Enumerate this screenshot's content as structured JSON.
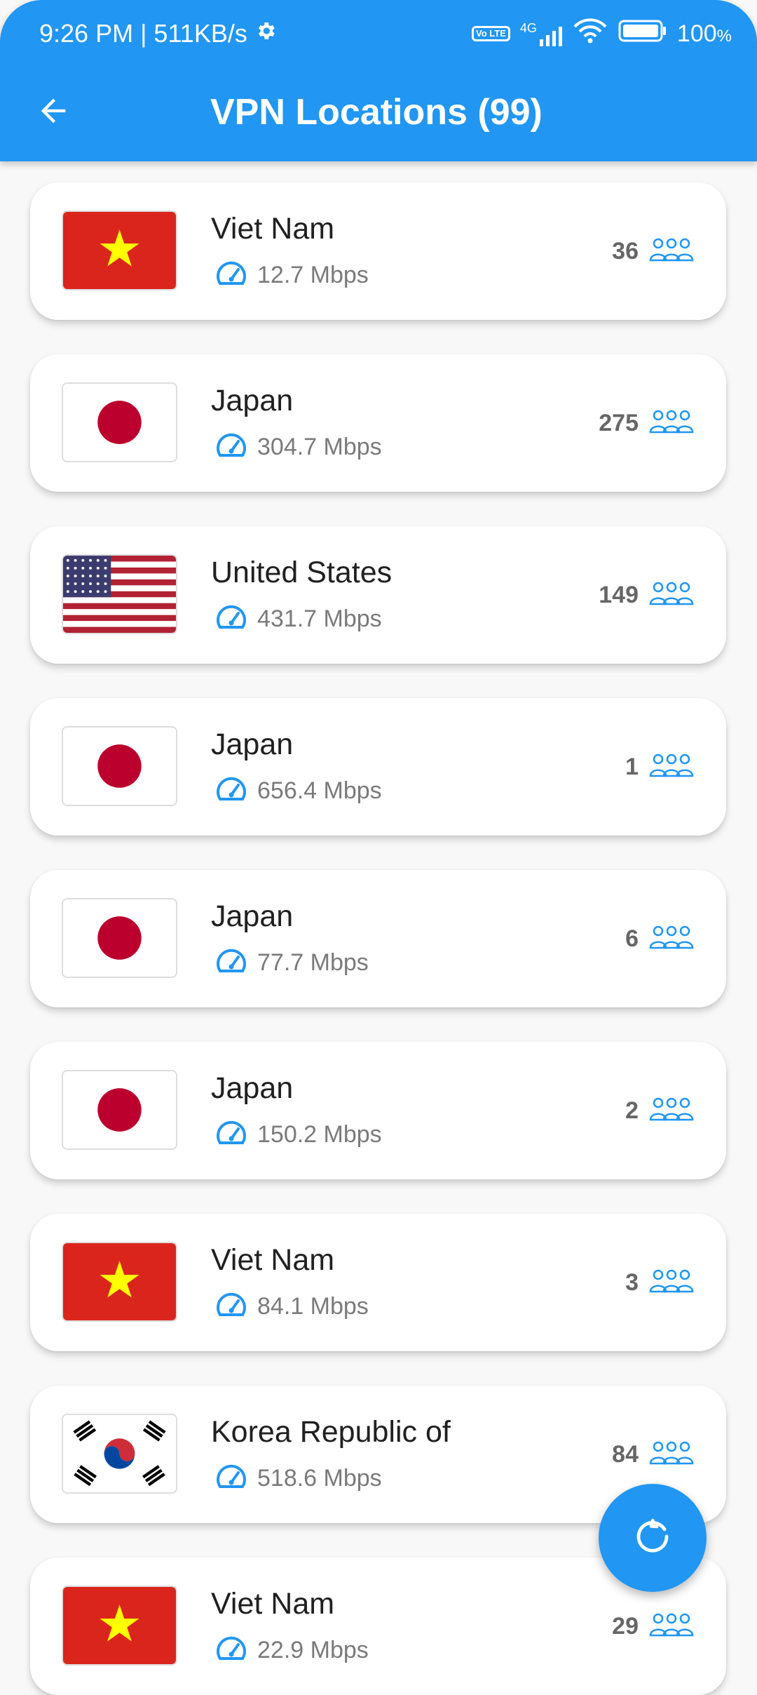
{
  "status_bar": {
    "time_speed": "9:26 PM | 511KB/s",
    "volte": "Vo LTE",
    "network": "4G",
    "battery": "100",
    "battery_unit": "%"
  },
  "appbar": {
    "title": "VPN Locations (99)",
    "back_icon": "arrow-left-icon",
    "background": "#2196f3"
  },
  "servers": [
    {
      "country": "Viet Nam",
      "flag": "vn",
      "speed": "12.7 Mbps",
      "users": "36"
    },
    {
      "country": "Japan",
      "flag": "jp",
      "speed": "304.7 Mbps",
      "users": "275"
    },
    {
      "country": "United States",
      "flag": "us",
      "speed": "431.7 Mbps",
      "users": "149"
    },
    {
      "country": "Japan",
      "flag": "jp",
      "speed": "656.4 Mbps",
      "users": "1"
    },
    {
      "country": "Japan",
      "flag": "jp",
      "speed": "77.7 Mbps",
      "users": "6"
    },
    {
      "country": "Japan",
      "flag": "jp",
      "speed": "150.2 Mbps",
      "users": "2"
    },
    {
      "country": "Viet Nam",
      "flag": "vn",
      "speed": "84.1 Mbps",
      "users": "3"
    },
    {
      "country": "Korea Republic of",
      "flag": "kr",
      "speed": "518.6 Mbps",
      "users": "84"
    },
    {
      "country": "Viet Nam",
      "flag": "vn",
      "speed": "22.9 Mbps",
      "users": "29"
    }
  ],
  "icons": {
    "speed": "speedometer-icon",
    "users": "users-group-icon",
    "refresh": "refresh-icon"
  },
  "colors": {
    "accent": "#2196f3",
    "speed_text": "#7a7a7a",
    "users_text": "#666666"
  }
}
